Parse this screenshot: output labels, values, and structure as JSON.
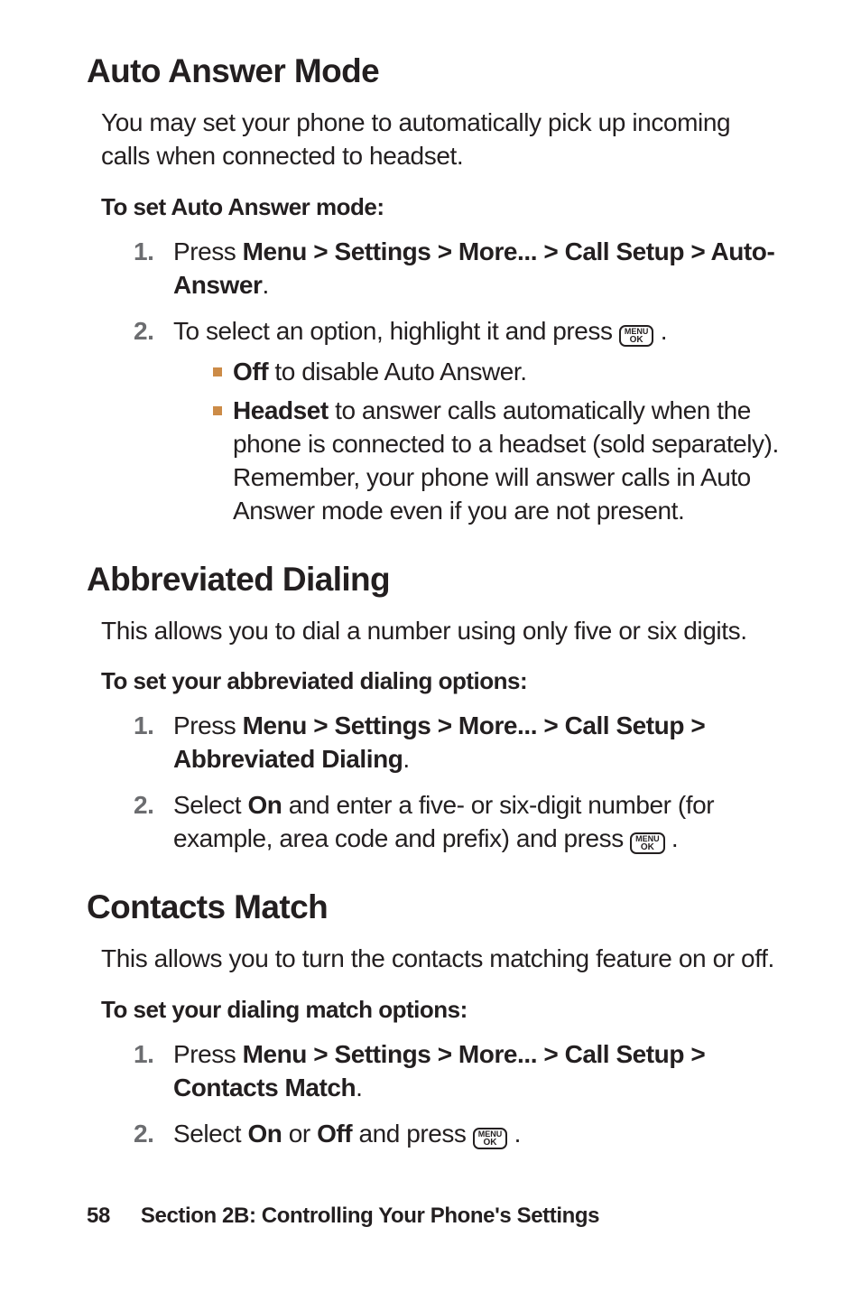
{
  "key_label_top": "MENU",
  "key_label_bottom": "OK",
  "sec1": {
    "heading": "Auto Answer Mode",
    "intro": "You may set your phone to automatically pick up incoming calls when connected to headset.",
    "sub": "To set Auto Answer mode:",
    "step1_pre": "Press ",
    "step1_bold": "Menu > Settings > More... > Call Setup > Auto-Answer",
    "step1_post": ".",
    "step2_pre": "To select an option, highlight it and press  ",
    "step2_post": " .",
    "bullet1_bold": "Off",
    "bullet1_rest": " to disable Auto Answer.",
    "bullet2_bold": "Headset",
    "bullet2_rest": " to answer calls automatically when the phone is connected to a headset (sold separately). Remember, your phone will answer calls in Auto Answer mode even if you are not present."
  },
  "sec2": {
    "heading": "Abbreviated Dialing",
    "intro": "This allows you to dial a number using only five or six digits.",
    "sub": "To set your abbreviated dialing options:",
    "step1_pre": "Press ",
    "step1_bold": "Menu > Settings > More... > Call Setup > Abbreviated Dialing",
    "step1_post": ".",
    "step2_a": "Select ",
    "step2_on": "On",
    "step2_b": " and enter a five- or six-digit number (for example, area code and prefix) and press  ",
    "step2_post": "  ."
  },
  "sec3": {
    "heading": "Contacts Match",
    "intro": "This allows you to turn the contacts matching feature on or off.",
    "sub": "To set your dialing match options:",
    "step1_pre": "Press ",
    "step1_bold": "Menu > Settings > More... > Call Setup > Contacts Match",
    "step1_post": ".",
    "step2_a": "Select ",
    "step2_on": "On",
    "step2_mid": " or ",
    "step2_off": "Off",
    "step2_b": " and press  ",
    "step2_post": " ."
  },
  "footer": {
    "page": "58",
    "title": "Section 2B: Controlling Your Phone's Settings"
  }
}
